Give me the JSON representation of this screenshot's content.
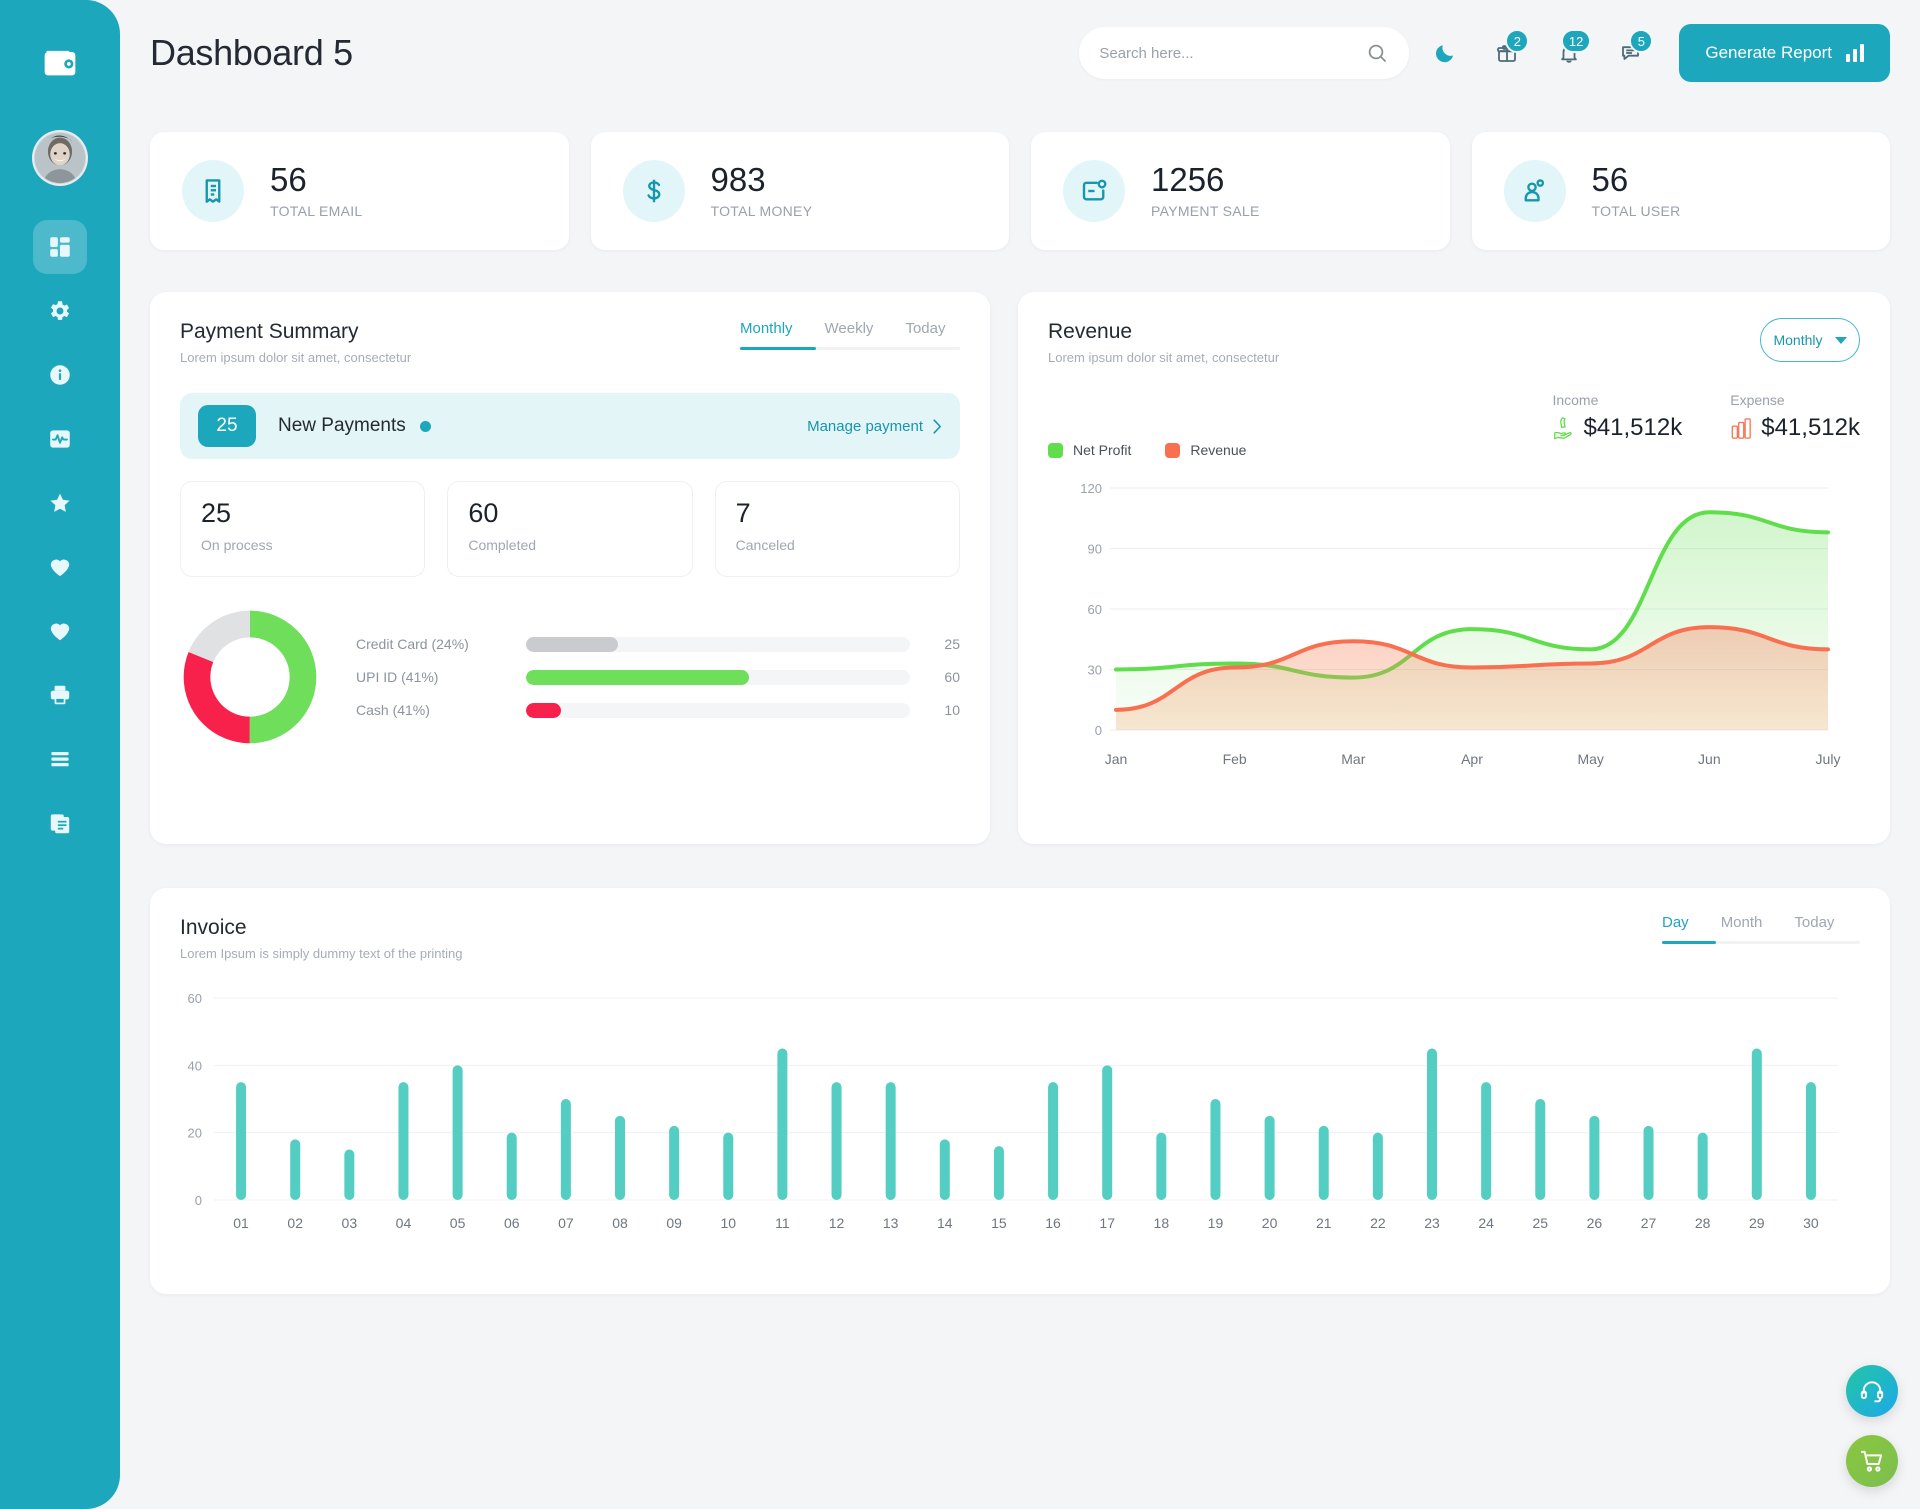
{
  "app": {
    "brand_icon": "wallet-icon",
    "page_title": "Dashboard 5"
  },
  "sidebar": {
    "avatar_alt": "user-avatar",
    "items": [
      {
        "icon": "dashboard-grid-icon",
        "active": true
      },
      {
        "icon": "gear-icon",
        "active": false
      },
      {
        "icon": "info-circle-icon",
        "active": false
      },
      {
        "icon": "activity-pulse-icon",
        "active": false
      },
      {
        "icon": "star-icon",
        "active": false
      },
      {
        "icon": "heart-icon",
        "active": false
      },
      {
        "icon": "heart-icon",
        "active": false
      },
      {
        "icon": "printer-icon",
        "active": false
      },
      {
        "icon": "menu-lines-icon",
        "active": false
      },
      {
        "icon": "documents-icon",
        "active": false
      }
    ]
  },
  "header": {
    "search_placeholder": "Search here...",
    "search_value": "",
    "search_icon": "search-icon",
    "dark_mode_icon": "moon-icon",
    "gift_icon": "gift-icon",
    "gift_badge": "2",
    "bell_icon": "bell-icon",
    "bell_badge": "12",
    "chat_icon": "chat-icon",
    "chat_badge": "5",
    "generate_report_label": "Generate Report",
    "generate_report_icon": "bar-chart-icon",
    "accent_color": "#1ca7bd"
  },
  "stats": [
    {
      "icon": "receipt-icon",
      "value": "56",
      "label": "TOTAL EMAIL"
    },
    {
      "icon": "dollar-icon",
      "value": "983",
      "label": "TOTAL MONEY"
    },
    {
      "icon": "payment-icon",
      "value": "1256",
      "label": "PAYMENT SALE"
    },
    {
      "icon": "users-icon",
      "value": "56",
      "label": "TOTAL USER"
    }
  ],
  "payment_summary": {
    "title": "Payment Summary",
    "subtitle": "Lorem ipsum dolor sit amet, consectetur",
    "tabs": [
      {
        "label": "Monthly",
        "active": true
      },
      {
        "label": "Weekly",
        "active": false
      },
      {
        "label": "Today",
        "active": false
      }
    ],
    "new_payments": {
      "count": "25",
      "label": "New Payments",
      "action_label": "Manage payment",
      "action_icon": "chevron-right-icon"
    },
    "metrics": [
      {
        "value": "25",
        "label": "On process"
      },
      {
        "value": "60",
        "label": "Completed"
      },
      {
        "value": "7",
        "label": "Canceled"
      }
    ],
    "chart_data": {
      "type": "pie",
      "title": "Payment methods",
      "labels": [
        "Credit Card (24%)",
        "UPI ID (41%)",
        "Cash (41%)"
      ],
      "values": [
        25,
        60,
        10
      ],
      "percents": [
        24,
        41,
        41
      ],
      "colors": [
        "#c9cbce",
        "#6ede5b",
        "#f8214b"
      ],
      "donut_segments": [
        {
          "name": "UPI ID",
          "color": "#6ede5b",
          "percent": 50
        },
        {
          "name": "Cash",
          "color": "#f8214b",
          "percent": 31
        },
        {
          "name": "Credit Card",
          "color": "#e0e1e3",
          "percent": 19
        }
      ],
      "bar_max": 100,
      "bar_fill_percent": [
        24,
        58,
        9
      ]
    }
  },
  "revenue": {
    "title": "Revenue",
    "subtitle": "Lorem ipsum dolor sit amet, consectetur",
    "select_value": "Monthly",
    "select_icon": "chevron-down-icon",
    "income_label": "Income",
    "income_value": "$41,512k",
    "income_icon": "money-hand-icon",
    "expense_label": "Expense",
    "expense_value": "$41,512k",
    "expense_icon": "coins-icon",
    "chart_data": {
      "type": "area",
      "title": "Revenue",
      "categories": [
        "Jan",
        "Feb",
        "Mar",
        "Apr",
        "May",
        "Jun",
        "July"
      ],
      "series": [
        {
          "name": "Net Profit",
          "color": "#5fdd4b",
          "values": [
            30,
            33,
            26,
            50,
            40,
            108,
            98
          ]
        },
        {
          "name": "Revenue",
          "color": "#f8704f",
          "values": [
            10,
            31,
            44,
            31,
            33,
            51,
            40
          ]
        }
      ],
      "ylim": [
        0,
        120
      ],
      "yticks": [
        0,
        30,
        60,
        90,
        120
      ],
      "xlabel": "",
      "ylabel": "",
      "grid": true,
      "legend_position": "top-left"
    }
  },
  "invoice": {
    "title": "Invoice",
    "subtitle": "Lorem Ipsum is simply dummy text of the printing",
    "tabs": [
      {
        "label": "Day",
        "active": true
      },
      {
        "label": "Month",
        "active": false
      },
      {
        "label": "Today",
        "active": false
      }
    ],
    "chart_data": {
      "type": "bar",
      "title": "Invoice",
      "categories": [
        "01",
        "02",
        "03",
        "04",
        "05",
        "06",
        "07",
        "08",
        "09",
        "10",
        "11",
        "12",
        "13",
        "14",
        "15",
        "16",
        "17",
        "18",
        "19",
        "20",
        "21",
        "22",
        "23",
        "24",
        "25",
        "26",
        "27",
        "28",
        "29",
        "30"
      ],
      "values": [
        35,
        18,
        15,
        35,
        40,
        20,
        30,
        25,
        22,
        20,
        45,
        35,
        35,
        18,
        16,
        35,
        40,
        20,
        30,
        25,
        22,
        20,
        45,
        35,
        30,
        25,
        22,
        20,
        45,
        35
      ],
      "color": "#54cdc2",
      "ylim": [
        0,
        60
      ],
      "yticks": [
        0,
        20,
        40,
        60
      ],
      "xlabel": "",
      "ylabel": "",
      "grid": true
    }
  },
  "floating": {
    "support_icon": "headset-icon",
    "cart_icon": "shopping-cart-icon"
  }
}
